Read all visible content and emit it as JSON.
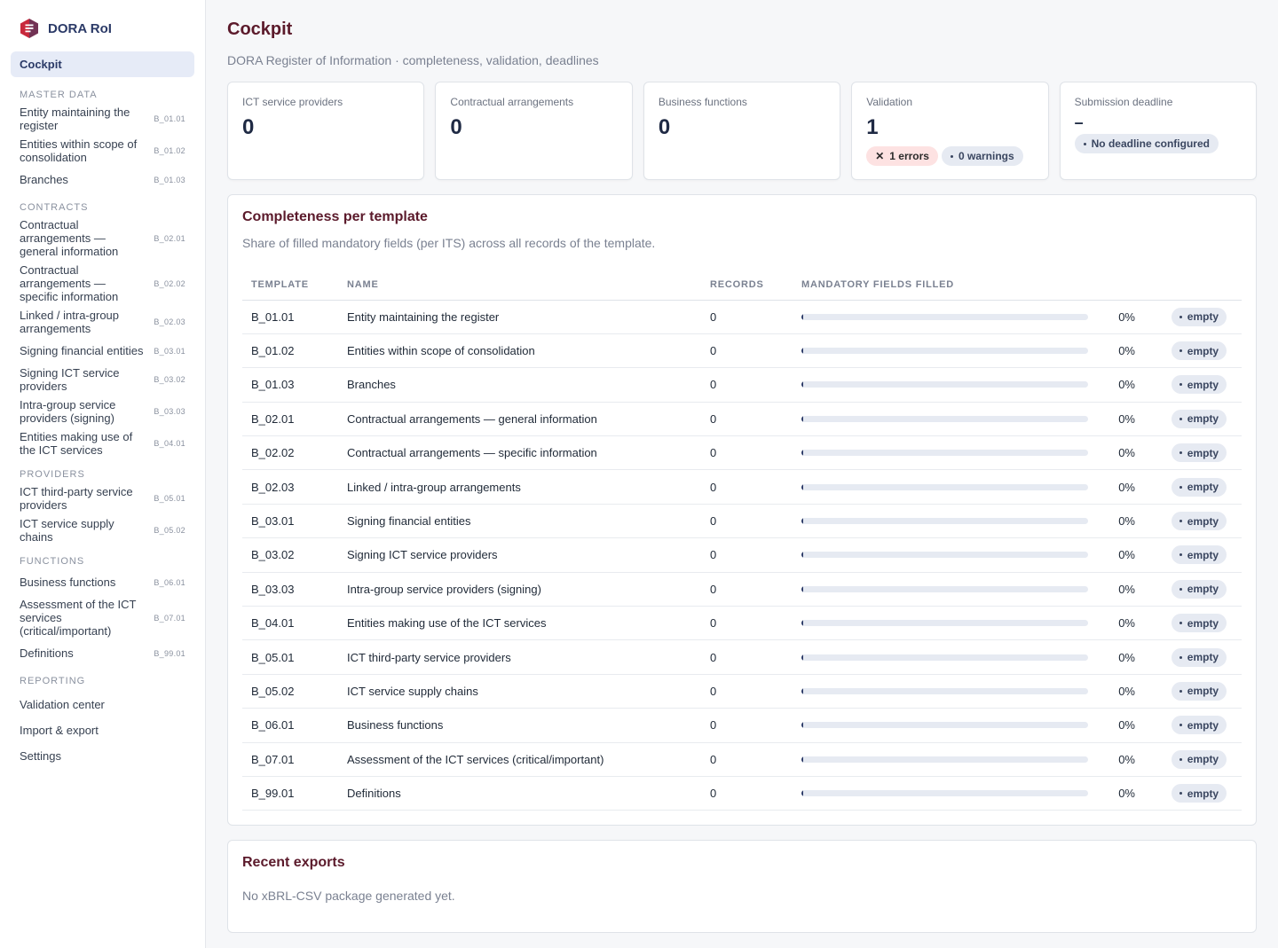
{
  "brand": {
    "name": "DORA RoI"
  },
  "nav": {
    "active": "Cockpit",
    "sections": [
      {
        "title": "MASTER DATA",
        "items": [
          {
            "label": "Entity maintaining the register",
            "code": "B_01.01"
          },
          {
            "label": "Entities within scope of consolidation",
            "code": "B_01.02"
          },
          {
            "label": "Branches",
            "code": "B_01.03"
          }
        ]
      },
      {
        "title": "CONTRACTS",
        "items": [
          {
            "label": "Contractual arrangements — general information",
            "code": "B_02.01"
          },
          {
            "label": "Contractual arrangements — specific information",
            "code": "B_02.02"
          },
          {
            "label": "Linked / intra-group arrangements",
            "code": "B_02.03"
          },
          {
            "label": "Signing financial entities",
            "code": "B_03.01"
          },
          {
            "label": "Signing ICT service providers",
            "code": "B_03.02"
          },
          {
            "label": "Intra-group service providers (signing)",
            "code": "B_03.03"
          },
          {
            "label": "Entities making use of the ICT services",
            "code": "B_04.01"
          }
        ]
      },
      {
        "title": "PROVIDERS",
        "items": [
          {
            "label": "ICT third-party service providers",
            "code": "B_05.01"
          },
          {
            "label": "ICT service supply chains",
            "code": "B_05.02"
          }
        ]
      },
      {
        "title": "FUNCTIONS",
        "items": [
          {
            "label": "Business functions",
            "code": "B_06.01"
          },
          {
            "label": "Assessment of the ICT services (critical/important)",
            "code": "B_07.01"
          },
          {
            "label": "Definitions",
            "code": "B_99.01"
          }
        ]
      },
      {
        "title": "REPORTING",
        "plain": [
          "Validation center",
          "Import & export",
          "Settings"
        ]
      }
    ]
  },
  "page": {
    "title": "Cockpit",
    "subtitle": "DORA Register of Information · completeness, validation, deadlines"
  },
  "cards": {
    "providers": {
      "label": "ICT service providers",
      "value": "0"
    },
    "contracts": {
      "label": "Contractual arrangements",
      "value": "0"
    },
    "functions": {
      "label": "Business functions",
      "value": "0"
    },
    "validation": {
      "label": "Validation",
      "value": "1",
      "errors": "1 errors",
      "warnings": "0 warnings"
    },
    "deadline": {
      "label": "Submission deadline",
      "value": "–",
      "status": "No deadline configured"
    }
  },
  "completeness": {
    "title": "Completeness per template",
    "subtitle": "Share of filled mandatory fields (per ITS) across all records of the template.",
    "headers": {
      "template": "TEMPLATE",
      "name": "NAME",
      "records": "RECORDS",
      "filled": "MANDATORY FIELDS FILLED"
    },
    "rows": [
      {
        "template": "B_01.01",
        "name": "Entity maintaining the register",
        "records": "0",
        "filled": 0,
        "pct": "0%",
        "status": "empty"
      },
      {
        "template": "B_01.02",
        "name": "Entities within scope of consolidation",
        "records": "0",
        "filled": 0,
        "pct": "0%",
        "status": "empty"
      },
      {
        "template": "B_01.03",
        "name": "Branches",
        "records": "0",
        "filled": 0,
        "pct": "0%",
        "status": "empty"
      },
      {
        "template": "B_02.01",
        "name": "Contractual arrangements — general information",
        "records": "0",
        "filled": 0,
        "pct": "0%",
        "status": "empty"
      },
      {
        "template": "B_02.02",
        "name": "Contractual arrangements — specific information",
        "records": "0",
        "filled": 0,
        "pct": "0%",
        "status": "empty"
      },
      {
        "template": "B_02.03",
        "name": "Linked / intra-group arrangements",
        "records": "0",
        "filled": 0,
        "pct": "0%",
        "status": "empty"
      },
      {
        "template": "B_03.01",
        "name": "Signing financial entities",
        "records": "0",
        "filled": 0,
        "pct": "0%",
        "status": "empty"
      },
      {
        "template": "B_03.02",
        "name": "Signing ICT service providers",
        "records": "0",
        "filled": 0,
        "pct": "0%",
        "status": "empty"
      },
      {
        "template": "B_03.03",
        "name": "Intra-group service providers (signing)",
        "records": "0",
        "filled": 0,
        "pct": "0%",
        "status": "empty"
      },
      {
        "template": "B_04.01",
        "name": "Entities making use of the ICT services",
        "records": "0",
        "filled": 0,
        "pct": "0%",
        "status": "empty"
      },
      {
        "template": "B_05.01",
        "name": "ICT third-party service providers",
        "records": "0",
        "filled": 0,
        "pct": "0%",
        "status": "empty"
      },
      {
        "template": "B_05.02",
        "name": "ICT service supply chains",
        "records": "0",
        "filled": 0,
        "pct": "0%",
        "status": "empty"
      },
      {
        "template": "B_06.01",
        "name": "Business functions",
        "records": "0",
        "filled": 0,
        "pct": "0%",
        "status": "empty"
      },
      {
        "template": "B_07.01",
        "name": "Assessment of the ICT services (critical/important)",
        "records": "0",
        "filled": 0,
        "pct": "0%",
        "status": "empty"
      },
      {
        "template": "B_99.01",
        "name": "Definitions",
        "records": "0",
        "filled": 0,
        "pct": "0%",
        "status": "empty"
      }
    ]
  },
  "exports": {
    "title": "Recent exports",
    "empty_text": "No xBRL-CSV package generated yet."
  },
  "colors": {
    "accent": "#2b3a67",
    "title": "#5b1a2b",
    "error_bg": "#fde2e2",
    "pill_bg": "#e6eaf2"
  },
  "icons": {
    "brand": "dora-logo-icon",
    "error": "x-icon",
    "dot": "dot-icon"
  }
}
